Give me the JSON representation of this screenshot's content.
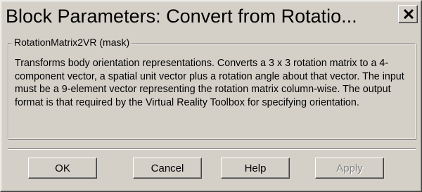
{
  "window": {
    "title": "Block Parameters: Convert from Rotatio..."
  },
  "group": {
    "legend": "RotationMatrix2VR (mask)",
    "description": "Transforms body orientation representations. Converts a 3 x 3 rotation matrix to a 4-component vector, a spatial unit vector plus a rotation angle about that vector. The input must be a 9-element vector representing the rotation matrix column-wise. The output format is that required by the Virtual Reality Toolbox for specifying orientation."
  },
  "buttons": {
    "ok": "OK",
    "cancel": "Cancel",
    "help": "Help",
    "apply": "Apply"
  },
  "icons": {
    "close": "close-icon"
  }
}
